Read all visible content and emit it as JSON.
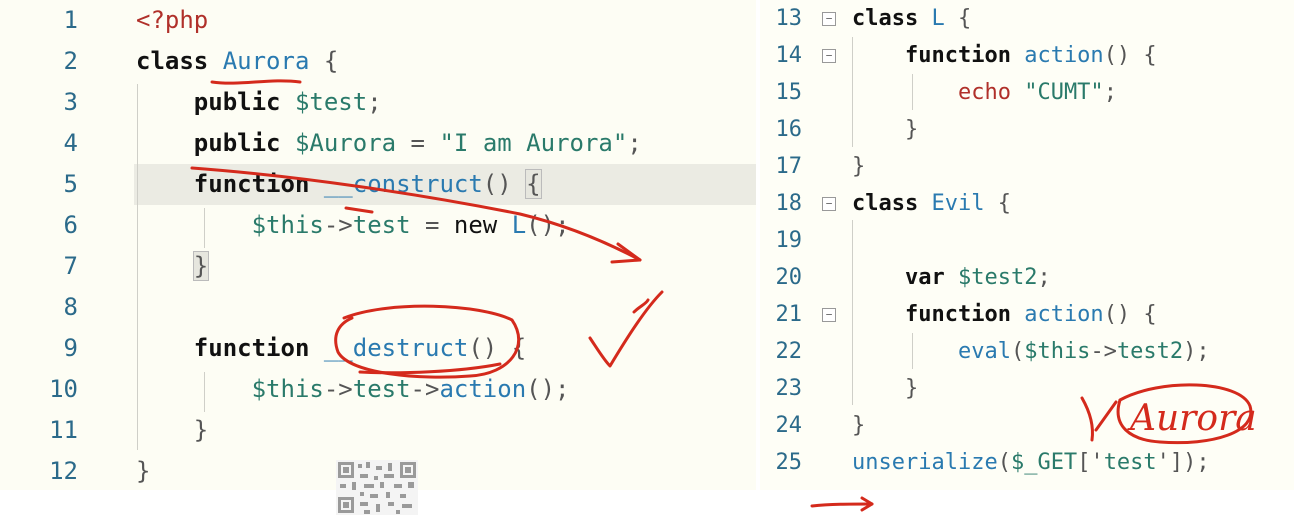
{
  "left_editor": {
    "lines": [
      {
        "n": "1",
        "tokens": [
          {
            "t": "<?php",
            "c": "tag"
          }
        ]
      },
      {
        "n": "2",
        "tokens": [
          {
            "t": "class",
            "c": "kw"
          },
          {
            "t": " ",
            "c": "op"
          },
          {
            "t": "Aurora",
            "c": "cls"
          },
          {
            "t": " {",
            "c": "op"
          }
        ]
      },
      {
        "n": "3",
        "tokens": [
          {
            "t": "    ",
            "c": "op"
          },
          {
            "t": "public",
            "c": "kw"
          },
          {
            "t": " ",
            "c": "op"
          },
          {
            "t": "$test",
            "c": "var"
          },
          {
            "t": ";",
            "c": "op"
          }
        ]
      },
      {
        "n": "4",
        "tokens": [
          {
            "t": "    ",
            "c": "op"
          },
          {
            "t": "public",
            "c": "kw"
          },
          {
            "t": " ",
            "c": "op"
          },
          {
            "t": "$Aurora",
            "c": "var"
          },
          {
            "t": " = ",
            "c": "op"
          },
          {
            "t": "\"I am Aurora\"",
            "c": "str"
          },
          {
            "t": ";",
            "c": "op"
          }
        ]
      },
      {
        "n": "5",
        "tokens": [
          {
            "t": "    ",
            "c": "op"
          },
          {
            "t": "function",
            "c": "kw"
          },
          {
            "t": " ",
            "c": "op"
          },
          {
            "t": "__construct",
            "c": "fn"
          },
          {
            "t": "() ",
            "c": "op"
          },
          {
            "t": "{",
            "c": "brace"
          }
        ]
      },
      {
        "n": "6",
        "tokens": [
          {
            "t": "        ",
            "c": "op"
          },
          {
            "t": "$this",
            "c": "var"
          },
          {
            "t": "->",
            "c": "op"
          },
          {
            "t": "test",
            "c": "var"
          },
          {
            "t": " = ",
            "c": "op"
          },
          {
            "t": "new",
            "c": "kwn"
          },
          {
            "t": " ",
            "c": "op"
          },
          {
            "t": "L",
            "c": "cls"
          },
          {
            "t": "();",
            "c": "op"
          }
        ]
      },
      {
        "n": "7",
        "tokens": [
          {
            "t": "    ",
            "c": "op"
          },
          {
            "t": "}",
            "c": "brace"
          }
        ]
      },
      {
        "n": "8",
        "tokens": []
      },
      {
        "n": "9",
        "tokens": [
          {
            "t": "    ",
            "c": "op"
          },
          {
            "t": "function",
            "c": "kw"
          },
          {
            "t": " ",
            "c": "op"
          },
          {
            "t": "__destruct",
            "c": "fn"
          },
          {
            "t": "() {",
            "c": "op"
          }
        ]
      },
      {
        "n": "10",
        "tokens": [
          {
            "t": "        ",
            "c": "op"
          },
          {
            "t": "$this",
            "c": "var"
          },
          {
            "t": "->",
            "c": "op"
          },
          {
            "t": "test",
            "c": "var"
          },
          {
            "t": "->",
            "c": "op"
          },
          {
            "t": "action",
            "c": "fn"
          },
          {
            "t": "();",
            "c": "op"
          }
        ]
      },
      {
        "n": "11",
        "tokens": [
          {
            "t": "    ",
            "c": "op"
          },
          {
            "t": "}",
            "c": "op"
          }
        ]
      },
      {
        "n": "12",
        "tokens": [
          {
            "t": "}",
            "c": "op"
          }
        ]
      }
    ]
  },
  "right_editor": {
    "lines": [
      {
        "n": "13",
        "fold": true,
        "tokens": [
          {
            "t": "class",
            "c": "kw"
          },
          {
            "t": " ",
            "c": "op"
          },
          {
            "t": "L",
            "c": "cls"
          },
          {
            "t": " {",
            "c": "op"
          }
        ]
      },
      {
        "n": "14",
        "fold": true,
        "tokens": [
          {
            "t": "    ",
            "c": "op"
          },
          {
            "t": "function",
            "c": "kw"
          },
          {
            "t": " ",
            "c": "op"
          },
          {
            "t": "action",
            "c": "fn"
          },
          {
            "t": "() {",
            "c": "op"
          }
        ]
      },
      {
        "n": "15",
        "fold": false,
        "tokens": [
          {
            "t": "        ",
            "c": "op"
          },
          {
            "t": "echo",
            "c": "echo"
          },
          {
            "t": " ",
            "c": "op"
          },
          {
            "t": "\"CUMT\"",
            "c": "str"
          },
          {
            "t": ";",
            "c": "op"
          }
        ]
      },
      {
        "n": "16",
        "fold": false,
        "tokens": [
          {
            "t": "    ",
            "c": "op"
          },
          {
            "t": "}",
            "c": "op"
          }
        ]
      },
      {
        "n": "17",
        "fold": false,
        "tokens": [
          {
            "t": "}",
            "c": "op"
          }
        ]
      },
      {
        "n": "18",
        "fold": true,
        "tokens": [
          {
            "t": "class",
            "c": "kw"
          },
          {
            "t": " ",
            "c": "op"
          },
          {
            "t": "Evil",
            "c": "cls"
          },
          {
            "t": " {",
            "c": "op"
          }
        ]
      },
      {
        "n": "19",
        "fold": false,
        "tokens": []
      },
      {
        "n": "20",
        "fold": false,
        "tokens": [
          {
            "t": "    ",
            "c": "op"
          },
          {
            "t": "var",
            "c": "kw"
          },
          {
            "t": " ",
            "c": "op"
          },
          {
            "t": "$test2",
            "c": "var"
          },
          {
            "t": ";",
            "c": "op"
          }
        ]
      },
      {
        "n": "21",
        "fold": true,
        "tokens": [
          {
            "t": "    ",
            "c": "op"
          },
          {
            "t": "function",
            "c": "kw"
          },
          {
            "t": " ",
            "c": "op"
          },
          {
            "t": "action",
            "c": "fn"
          },
          {
            "t": "() {",
            "c": "op"
          }
        ]
      },
      {
        "n": "22",
        "fold": false,
        "tokens": [
          {
            "t": "        ",
            "c": "op"
          },
          {
            "t": "eval",
            "c": "fn"
          },
          {
            "t": "(",
            "c": "op"
          },
          {
            "t": "$this",
            "c": "var"
          },
          {
            "t": "->",
            "c": "op"
          },
          {
            "t": "test2",
            "c": "var"
          },
          {
            "t": ");",
            "c": "op"
          }
        ]
      },
      {
        "n": "23",
        "fold": false,
        "tokens": [
          {
            "t": "    ",
            "c": "op"
          },
          {
            "t": "}",
            "c": "op"
          }
        ]
      },
      {
        "n": "24",
        "fold": false,
        "tokens": [
          {
            "t": "}",
            "c": "op"
          }
        ]
      },
      {
        "n": "25",
        "fold": false,
        "tokens": [
          {
            "t": "unserialize",
            "c": "fn"
          },
          {
            "t": "(",
            "c": "op"
          },
          {
            "t": "$_GET",
            "c": "var"
          },
          {
            "t": "['",
            "c": "op"
          },
          {
            "t": "test",
            "c": "str"
          },
          {
            "t": "']);",
            "c": "op"
          }
        ]
      }
    ]
  },
  "fold_glyph": "−",
  "annotation": {
    "handwritten_word": "Aurora",
    "ink_color": "#d42a1c"
  },
  "qr_code": {
    "icon": "qr-code-icon"
  }
}
